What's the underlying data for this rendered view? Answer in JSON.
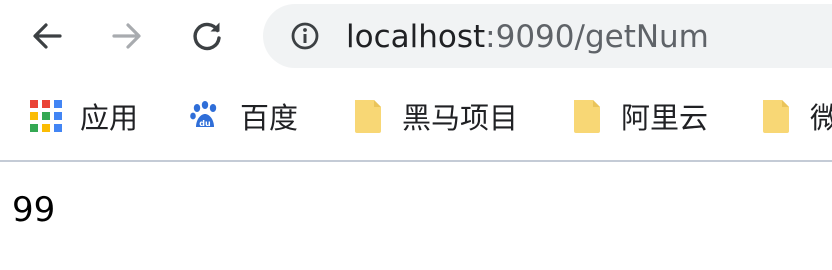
{
  "toolbar": {
    "back_icon": "arrow-left-icon",
    "forward_icon": "arrow-right-icon",
    "reload_icon": "reload-icon",
    "info_icon": "info-circle-icon",
    "address": {
      "host": "localhost",
      "rest": ":9090/getNum"
    }
  },
  "bookmarks": {
    "items": [
      {
        "label": "应用",
        "icon": "apps-grid-icon"
      },
      {
        "label": "百度",
        "icon": "baidu-paw-icon"
      },
      {
        "label": "黑马项目",
        "icon": "folder-icon"
      },
      {
        "label": "阿里云",
        "icon": "folder-icon"
      },
      {
        "label": "微",
        "icon": "folder-icon"
      }
    ]
  },
  "page": {
    "body_text": "99"
  },
  "colors": {
    "omnibox_bg": "#f1f3f4",
    "folder_yellow": "#f8d775",
    "divider": "#c4cbd6"
  }
}
